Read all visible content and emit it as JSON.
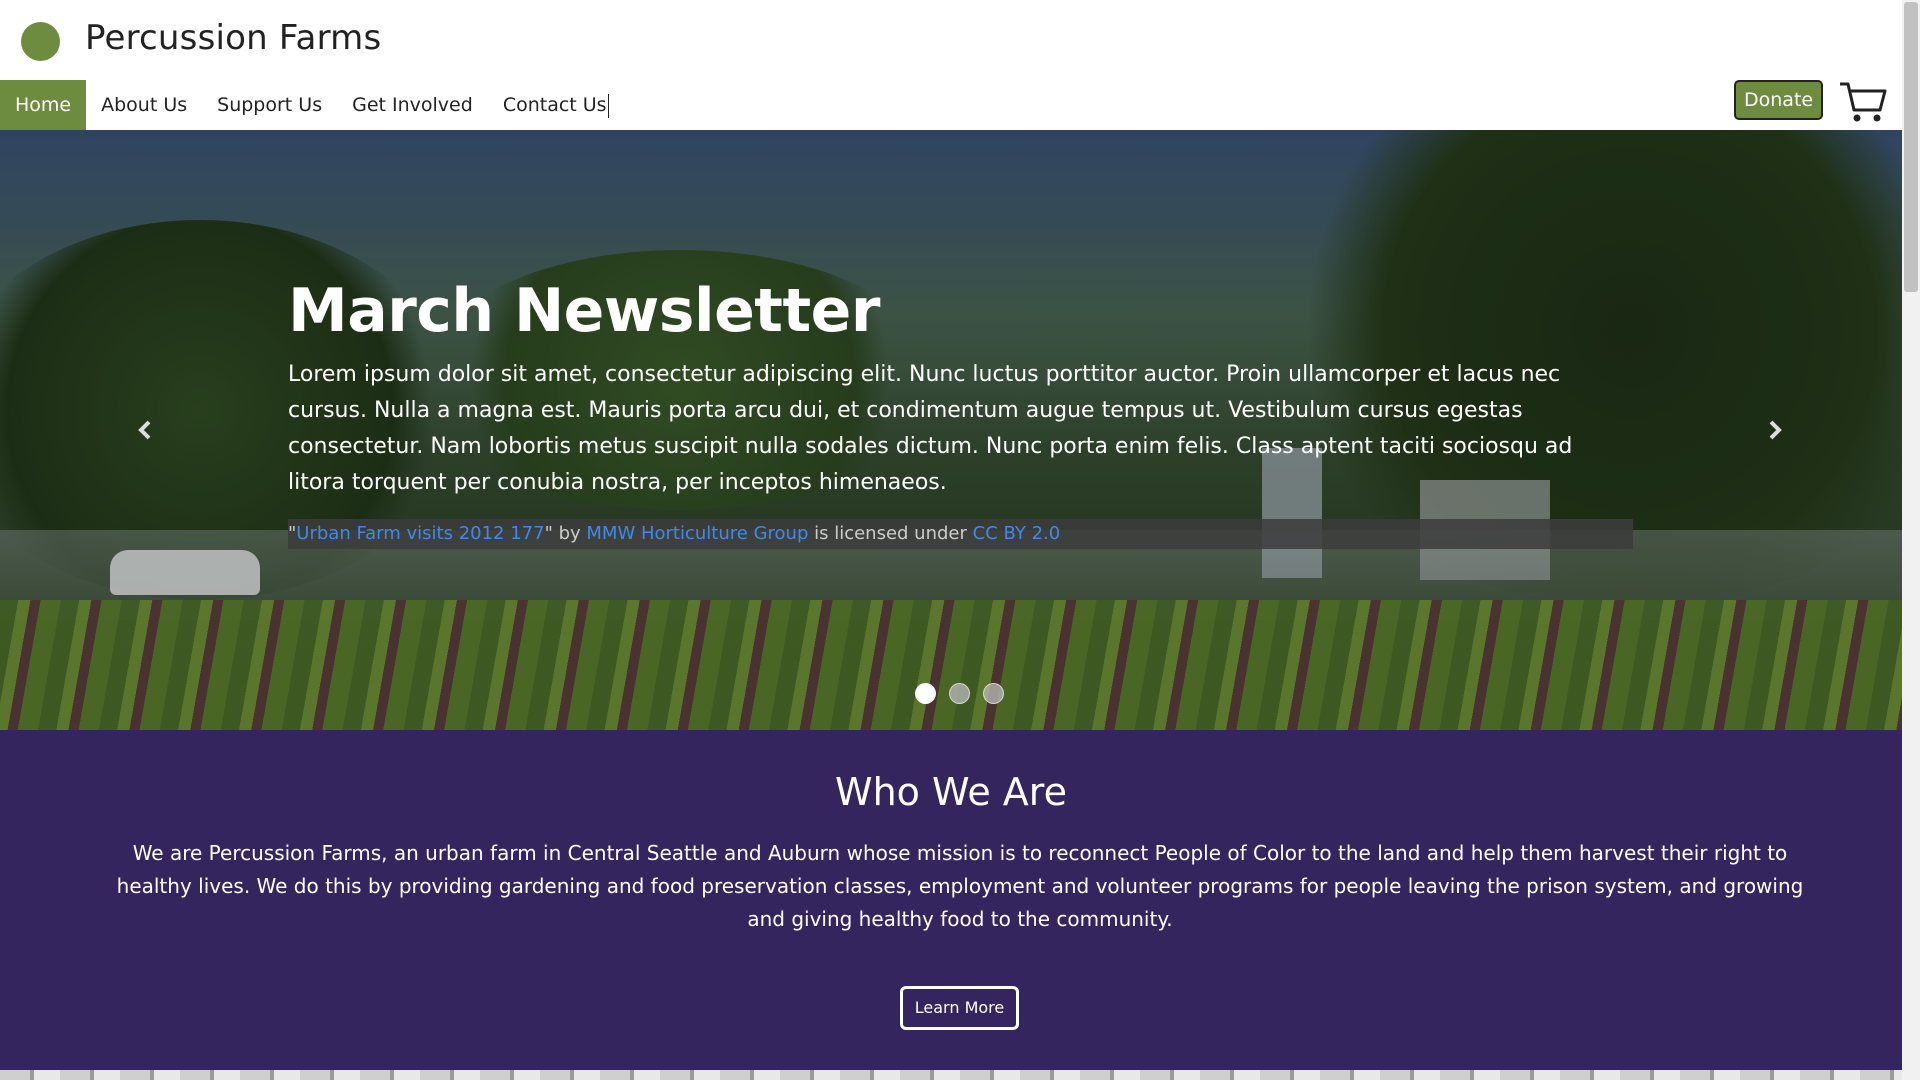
{
  "site": {
    "title": "Percussion Farms",
    "brand_color": "#6e8c3f"
  },
  "nav": {
    "items": [
      {
        "label": "Home",
        "active": true
      },
      {
        "label": "About Us",
        "active": false
      },
      {
        "label": "Support Us",
        "active": false
      },
      {
        "label": "Get Involved",
        "active": false
      },
      {
        "label": "Contact Us",
        "active": false
      }
    ],
    "donate_label": "Donate",
    "cart_icon": "cart-icon"
  },
  "hero": {
    "title": "March Newsletter",
    "text": "Lorem ipsum dolor sit amet, consectetur adipiscing elit. Nunc luctus porttitor auctor. Proin ullamcorper et lacus nec cursus. Nulla a magna est. Mauris porta arcu dui, et condimentum augue tempus ut. Vestibulum cursus egestas consectetur. Nam lobortis metus suscipit nulla sodales dictum. Nunc porta enim felis. Class aptent taciti sociosqu ad litora torquent per conubia nostra, per inceptos himenaeos.",
    "credit": {
      "quote_open": "\"",
      "work": "Urban Farm visits 2012 177",
      "quote_close": "\" by ",
      "author": "MMW Horticulture Group",
      "licensed": " is licensed under ",
      "license": "CC BY 2.0"
    },
    "prev_icon": "chevron-left-icon",
    "next_icon": "chevron-right-icon",
    "slide_count": 3,
    "active_slide": 1
  },
  "who": {
    "title": "Who We Are",
    "text": "We are Percussion Farms, an urban farm in Central Seattle and Auburn whose mission is to reconnect People of Color to the land and help them harvest their right to healthy lives. We do this by providing gardening and food preservation classes, employment and volunteer programs for people leaving the prison system, and growing and giving healthy food to the community.",
    "button_label": "Learn More",
    "bg_color": "#35255f"
  }
}
